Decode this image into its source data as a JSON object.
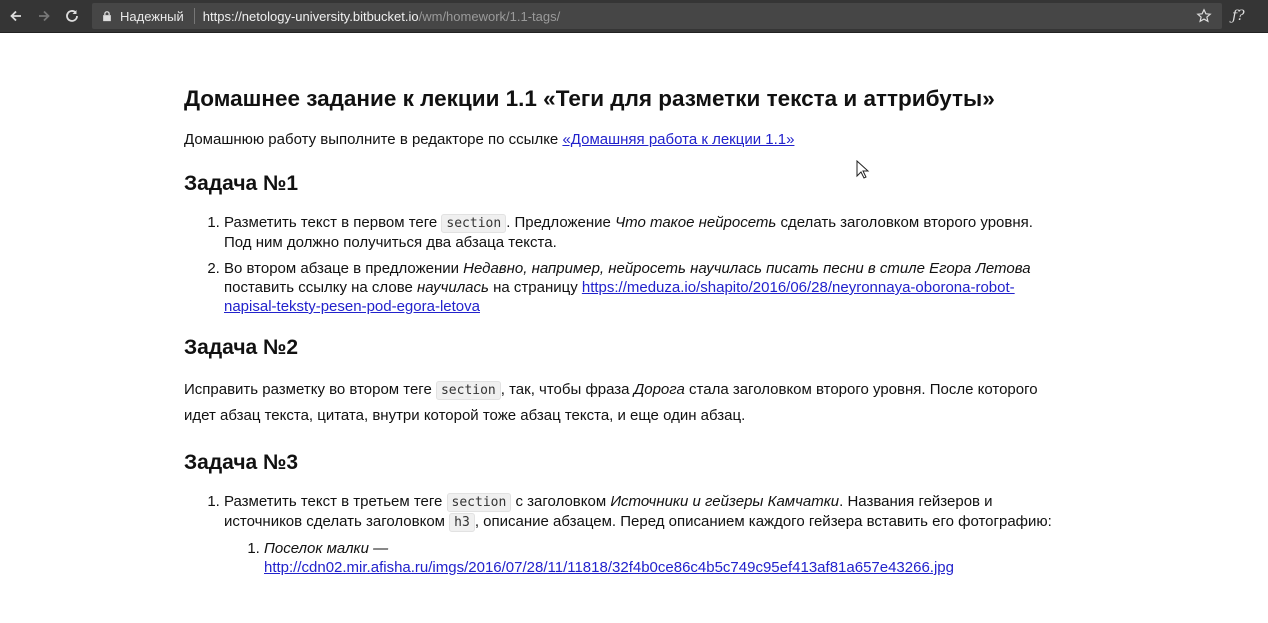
{
  "browser": {
    "secure_label": "Надежный",
    "url_host": "https://netology-university.bitbucket.io",
    "url_path": "/wm/homework/1.1-tags/",
    "extension_label": "ƒ?"
  },
  "page": {
    "title": "Домашнее задание к лекции 1.1 «Теги для разметки текста и аттрибуты»",
    "intro_text": "Домашнюю работу выполните в редакторе по ссылке ",
    "intro_link": "«Домашняя работа к лекции 1.1»",
    "task1": {
      "heading": "Задача №1",
      "item1_a": "Разметить текст в первом теге ",
      "item1_code": "section",
      "item1_b": ". Предложение ",
      "item1_em": "Что такое нейросеть",
      "item1_c": " сделать заголовком второго уровня. Под ним должно получиться два абзаца текста.",
      "item2_a": "Во втором абзаце в предложении ",
      "item2_em1": "Недавно, например, нейросеть научилась писать песни в стиле Егора Летова",
      "item2_b": " поставить ссылку на слове ",
      "item2_em2": "научилась",
      "item2_c": " на страницу ",
      "item2_link": "https://meduza.io/shapito/2016/06/28/neyronnaya-oborona-robot-napisal-teksty-pesen-pod-egora-letova"
    },
    "task2": {
      "heading": "Задача №2",
      "text_a": "Исправить разметку во втором теге ",
      "code": "section",
      "text_b": ", так, чтобы фраза ",
      "em": "Дорога",
      "text_c": " стала заголовком второго уровня. После которого идет абзац текста, цитата, внутри которой тоже абзац текста, и еще один абзац."
    },
    "task3": {
      "heading": "Задача №3",
      "item1_a": "Разметить текст в третьем теге ",
      "item1_code": "section",
      "item1_b": " с заголовком ",
      "item1_em": "Источники и гейзеры Камчатки",
      "item1_c": ". Названия гейзеров и источников сделать заголовком ",
      "item1_code2": "h3",
      "item1_d": ", описание абзацем. Перед описанием каждого гейзера вставить его фотографию:",
      "sub1_em": "Поселок малки —",
      "sub1_link": "http://cdn02.mir.afisha.ru/imgs/2016/07/28/11/11818/32f4b0ce86c4b5c749c95ef413af81a657e43266.jpg"
    }
  }
}
